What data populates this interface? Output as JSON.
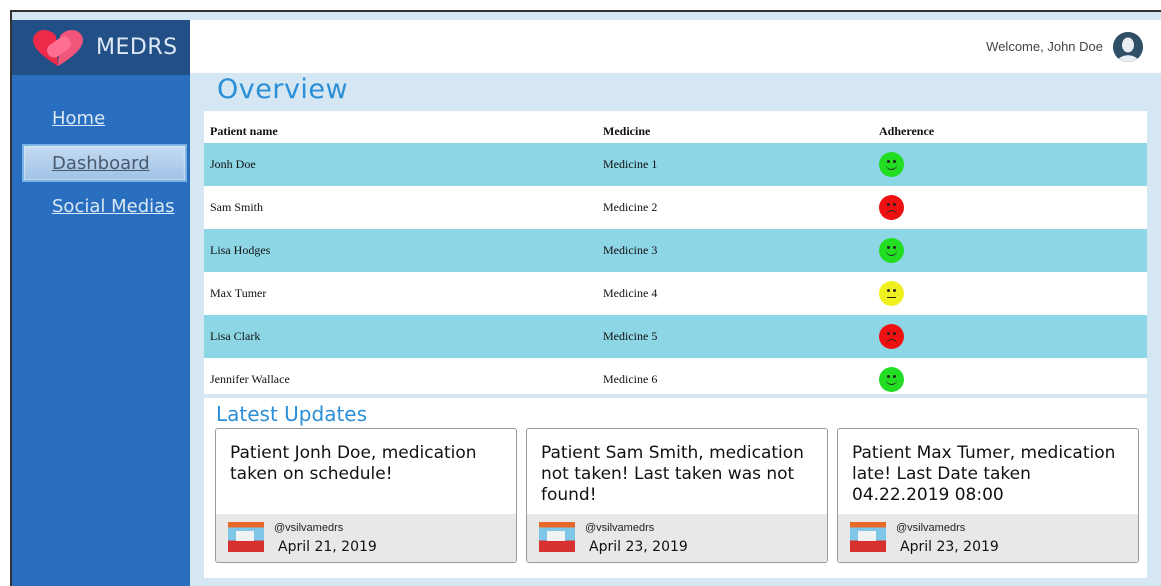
{
  "app": {
    "name": "MEDRS"
  },
  "header": {
    "welcome": "Welcome, John Doe"
  },
  "nav": [
    {
      "label": "Home"
    },
    {
      "label": "Dashboard",
      "active": true
    },
    {
      "label": "Social Medias"
    }
  ],
  "page_title": "Overview",
  "table": {
    "headers": [
      "Patient name",
      "Medicine",
      "Adherence"
    ],
    "rows": [
      {
        "patient": "Jonh Doe",
        "medicine": "Medicine 1",
        "adherence": "happy-green"
      },
      {
        "patient": "Sam Smith",
        "medicine": "Medicine 2",
        "adherence": "sad-red"
      },
      {
        "patient": "Lisa Hodges",
        "medicine": "Medicine 3",
        "adherence": "happy-green"
      },
      {
        "patient": "Max Tumer",
        "medicine": "Medicine 4",
        "adherence": "neutral-yellow"
      },
      {
        "patient": "Lisa Clark",
        "medicine": "Medicine 5",
        "adherence": "sad-red"
      },
      {
        "patient": "Jennifer Wallace",
        "medicine": "Medicine 6",
        "adherence": "happy-green"
      }
    ]
  },
  "updates": {
    "title": "Latest Updates",
    "cards": [
      {
        "text": "Patient Jonh Doe, medication taken on schedule!",
        "handle": "@vsilvamedrs",
        "date": "April 21, 2019"
      },
      {
        "text": "Patient Sam Smith, medication not taken! Last taken was not found!",
        "handle": "@vsilvamedrs",
        "date": "April 23, 2019"
      },
      {
        "text": "Patient Max Tumer, medication late! Last Date taken 04.22.2019 08:00",
        "handle": "@vsilvamedrs",
        "date": "April 23, 2019"
      }
    ]
  },
  "colors": {
    "sidebar": "#2a6fbf",
    "logo_bar": "#214f86",
    "accent": "#2a8fd6",
    "row_shade": "#8dd6e5",
    "happy": "#22dd22",
    "sad": "#ee1111",
    "neutral": "#f0f020"
  }
}
